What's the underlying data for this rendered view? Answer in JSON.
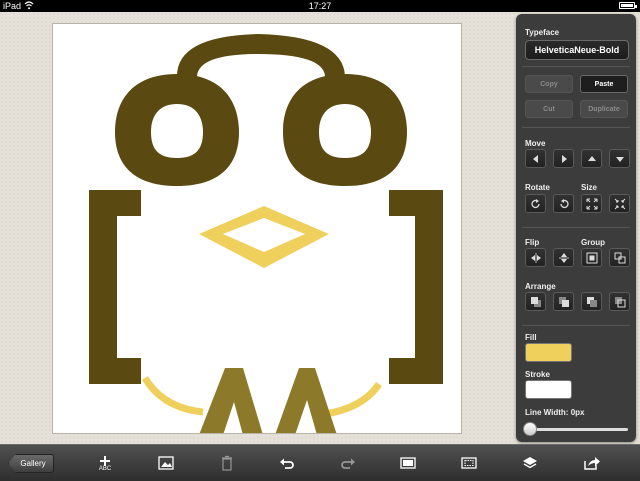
{
  "status_bar": {
    "device": "iPad",
    "time": "17:27"
  },
  "inspector": {
    "typeface_label": "Typeface",
    "typeface_value": "HelveticaNeue-Bold",
    "copy_label": "Copy",
    "paste_label": "Paste",
    "cut_label": "Cut",
    "duplicate_label": "Duplicate",
    "move_label": "Move",
    "rotate_label": "Rotate",
    "size_label": "Size",
    "flip_label": "Flip",
    "group_label": "Group",
    "arrange_label": "Arrange",
    "fill_label": "Fill",
    "fill_color": "#f0d05c",
    "stroke_label": "Stroke",
    "stroke_color": "#ffffff",
    "line_width_label": "Line Width: 0px",
    "line_width_value": 0
  },
  "toolbar": {
    "gallery_label": "Gallery",
    "add_text_sub": "ABC",
    "icons": [
      "add-text-icon",
      "image-icon",
      "trash-icon",
      "undo-icon",
      "redo-icon",
      "canvas-size-icon",
      "crop-icon",
      "layers-icon",
      "share-icon"
    ]
  },
  "artwork": {
    "dark_color": "#5a4a12",
    "yellow_color": "#f0d05c",
    "olive_color": "#8c7a2a"
  }
}
